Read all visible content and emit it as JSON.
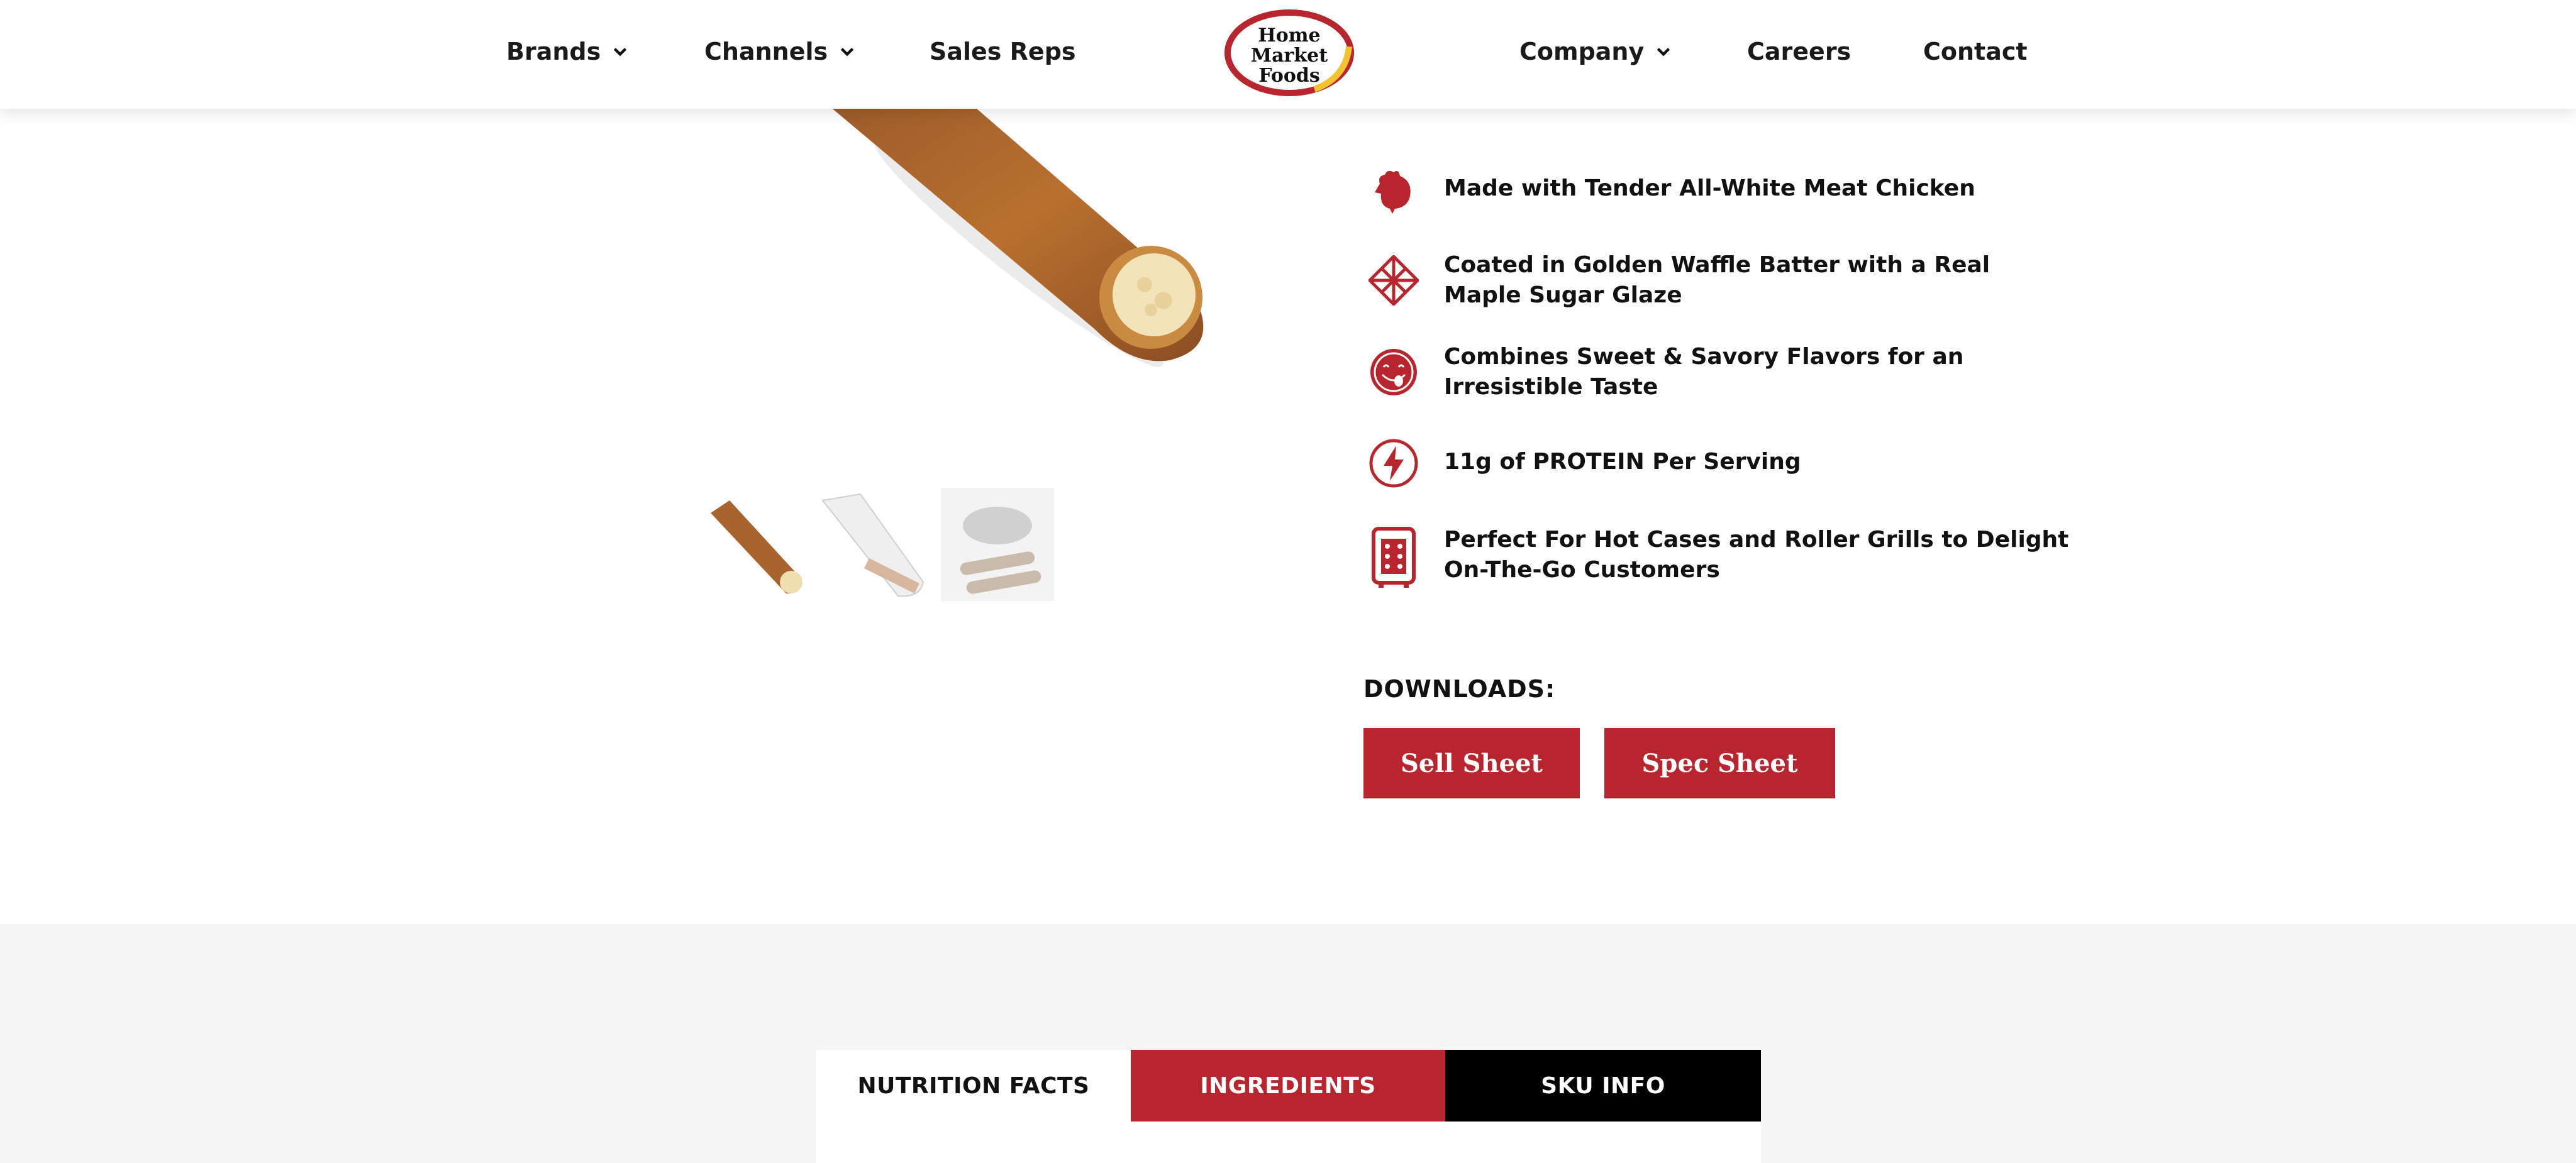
{
  "nav": {
    "brands": "Brands",
    "channels": "Channels",
    "sales_reps": "Sales Reps",
    "company": "Company",
    "careers": "Careers",
    "contact": "Contact",
    "logo": {
      "line1": "Home",
      "line2": "Market",
      "line3": "Foods"
    }
  },
  "features": [
    {
      "icon": "chicken-icon",
      "text": "Made with Tender All-White Meat Chicken"
    },
    {
      "icon": "waffle-icon",
      "text": "Coated in Golden Waffle Batter with a Real Maple Sugar Glaze"
    },
    {
      "icon": "smiley-tongue-icon",
      "text": "Combines Sweet & Savory Flavors for an Irresistible Taste"
    },
    {
      "icon": "lightning-icon",
      "text": "11g of PROTEIN Per Serving"
    },
    {
      "icon": "roller-grill-icon",
      "text": "Perfect For Hot Cases and Roller Grills to Delight On-The-Go Customers"
    }
  ],
  "downloads": {
    "title": "DOWNLOADS:",
    "sell_sheet": "Sell Sheet",
    "spec_sheet": "Spec Sheet"
  },
  "tabs": {
    "nutrition": "NUTRITION FACTS",
    "ingredients": "INGREDIENTS",
    "sku": "SKU INFO"
  },
  "colors": {
    "brand_red": "#b8252f",
    "black": "#000000",
    "band_grey": "#f5f5f5"
  }
}
